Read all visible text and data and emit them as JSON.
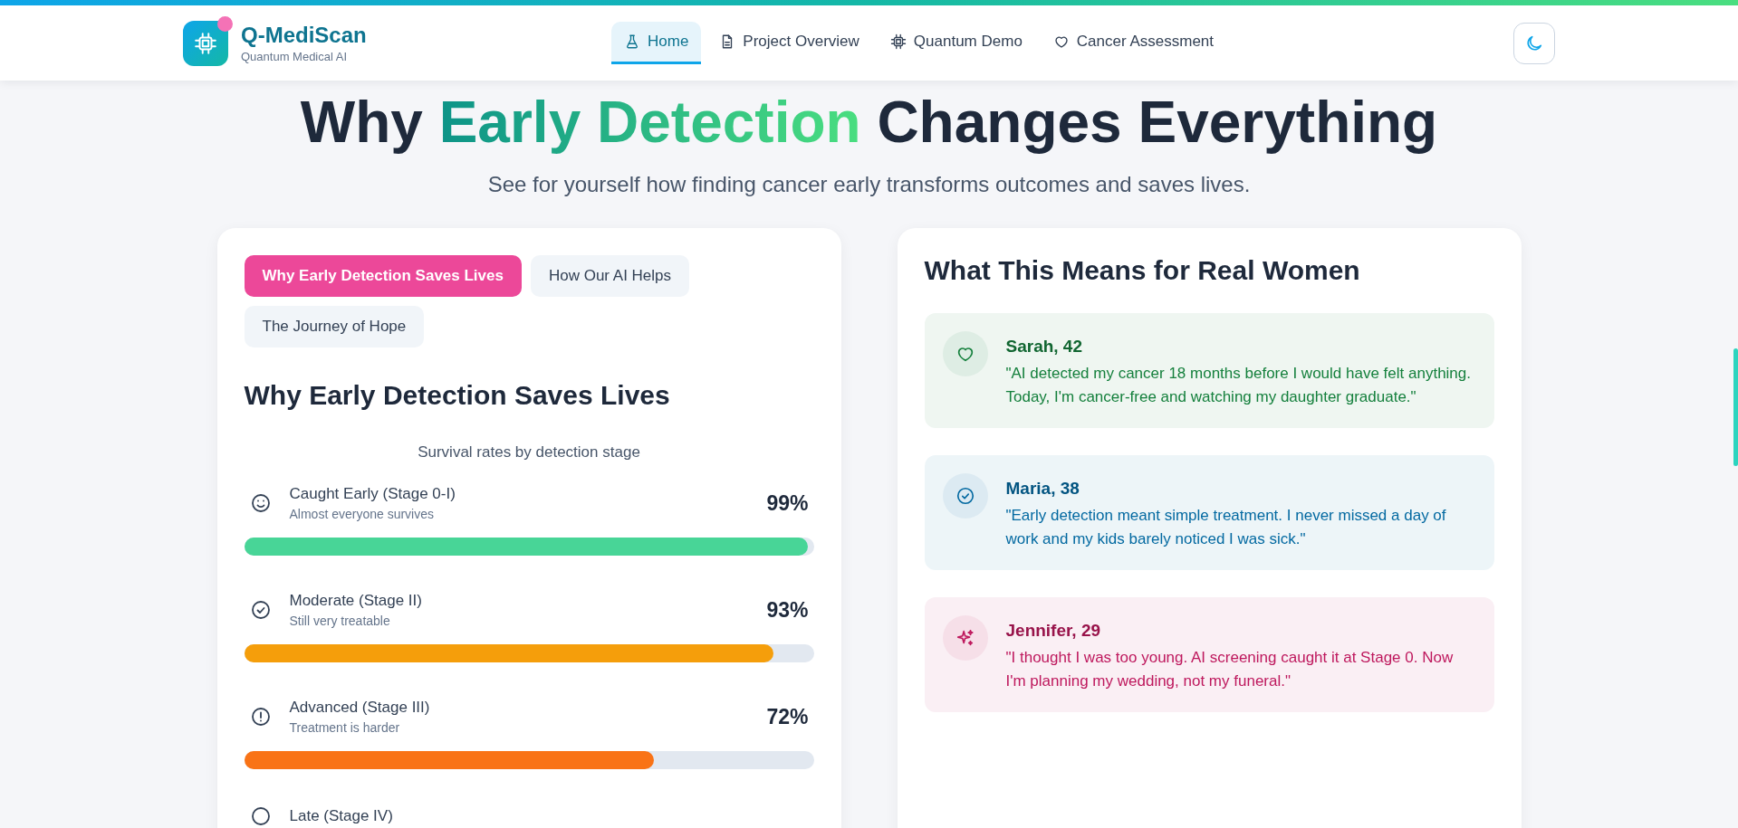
{
  "header": {
    "brand": "Q-MediScan",
    "tagline": "Quantum Medical AI",
    "nav": [
      {
        "label": "Home",
        "selected": true
      },
      {
        "label": "Project Overview",
        "selected": false
      },
      {
        "label": "Quantum Demo",
        "selected": false
      },
      {
        "label": "Cancer Assessment",
        "selected": false
      }
    ]
  },
  "hero": {
    "title_before": "Why",
    "title_highlight": "Early Detection",
    "title_after": "Changes Everything",
    "subtitle": "See for yourself how finding cancer early transforms outcomes and saves lives."
  },
  "left_card": {
    "tabs": [
      {
        "label": "Why Early Detection Saves Lives",
        "selected": true
      },
      {
        "label": "How Our AI Helps",
        "selected": false
      },
      {
        "label": "The Journey of Hope",
        "selected": false
      }
    ],
    "heading": "Why Early Detection Saves Lives",
    "caption": "Survival rates by detection stage",
    "stages": [
      {
        "label": "Caught Early (Stage 0-I)",
        "note": "Almost everyone survives",
        "reading": "99%",
        "level": 0.99,
        "color": "#48d597"
      },
      {
        "label": "Moderate (Stage II)",
        "note": "Still very treatable",
        "reading": "93%",
        "level": 0.93,
        "color": "#f59e0b"
      },
      {
        "label": "Advanced (Stage III)",
        "note": "Treatment is harder",
        "reading": "72%",
        "level": 0.72,
        "color": "#f97316"
      },
      {
        "label": "Late (Stage IV)"
      }
    ]
  },
  "right_card": {
    "heading": "What This Means for Real Women",
    "stories": [
      {
        "name": "Sarah, 42",
        "quote": "\"AI detected my cancer 18 months before I would have felt anything. Today, I'm cancer-free and watching my daughter graduate.\"",
        "color": "#15803d"
      },
      {
        "name": "Maria, 38",
        "quote": "\"Early detection meant simple treatment. I never missed a day of work and my kids barely noticed I was sick.\"",
        "color": "#0369a1"
      },
      {
        "name": "Jennifer, 29",
        "quote": "\"I thought I was too young. AI screening caught it at Stage 0. Now I'm planning my wedding, not my funeral.\"",
        "color": "#be185d"
      }
    ]
  }
}
